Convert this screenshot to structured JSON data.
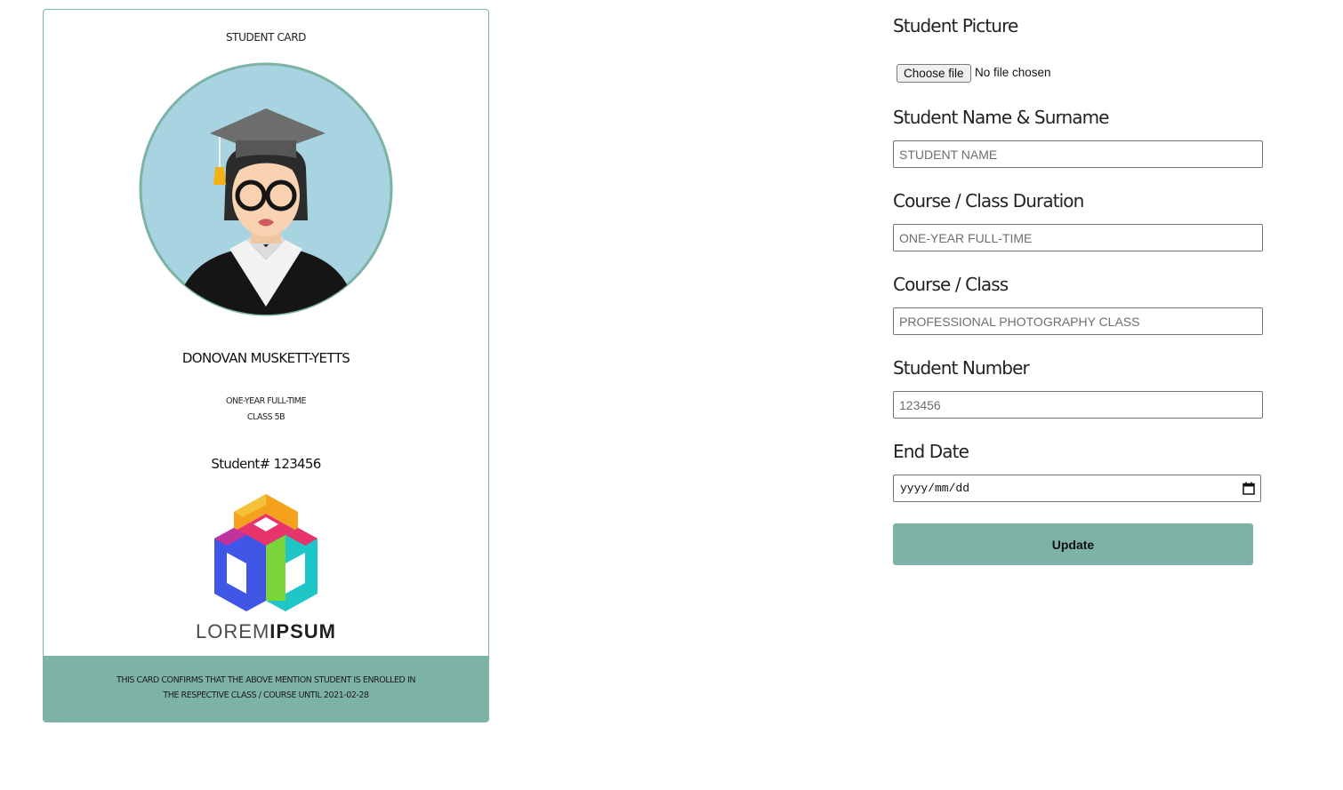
{
  "card": {
    "title": "STUDENT CARD",
    "name": "DONOVAN MUSKETT-YETTS",
    "duration": "ONE-YEAR FULL-TIME",
    "class": "CLASS 5B",
    "number_label": "Student# 123456",
    "logo": {
      "word1": "LOREM",
      "word2": "IPSUM"
    },
    "footer_line1": "THIS CARD CONFIRMS THAT THE ABOVE MENTION STUDENT IS ENROLLED IN",
    "footer_line2": "THE RESPECTIVE CLASS / COURSE UNTIL 2021-02-28"
  },
  "form": {
    "picture_label": "Student Picture",
    "file_button": "Choose file",
    "file_status": "No file chosen",
    "name_label": "Student Name & Surname",
    "name_placeholder": "STUDENT NAME",
    "duration_label": "Course / Class Duration",
    "duration_placeholder": "ONE-YEAR FULL-TIME",
    "class_label": "Course / Class",
    "class_placeholder": "PROFESSIONAL PHOTOGRAPHY CLASS",
    "number_label": "Student Number",
    "number_placeholder": "123456",
    "end_date_label": "End Date",
    "end_date_placeholder": "yyyy/mm/dd",
    "update_button": "Update"
  },
  "icons": {
    "avatar": "graduate-avatar-icon",
    "logo": "cube-logo-icon",
    "calendar": "calendar-icon"
  },
  "colors": {
    "accent": "#7db3a6",
    "avatar_bg": "#a7d4e0"
  }
}
